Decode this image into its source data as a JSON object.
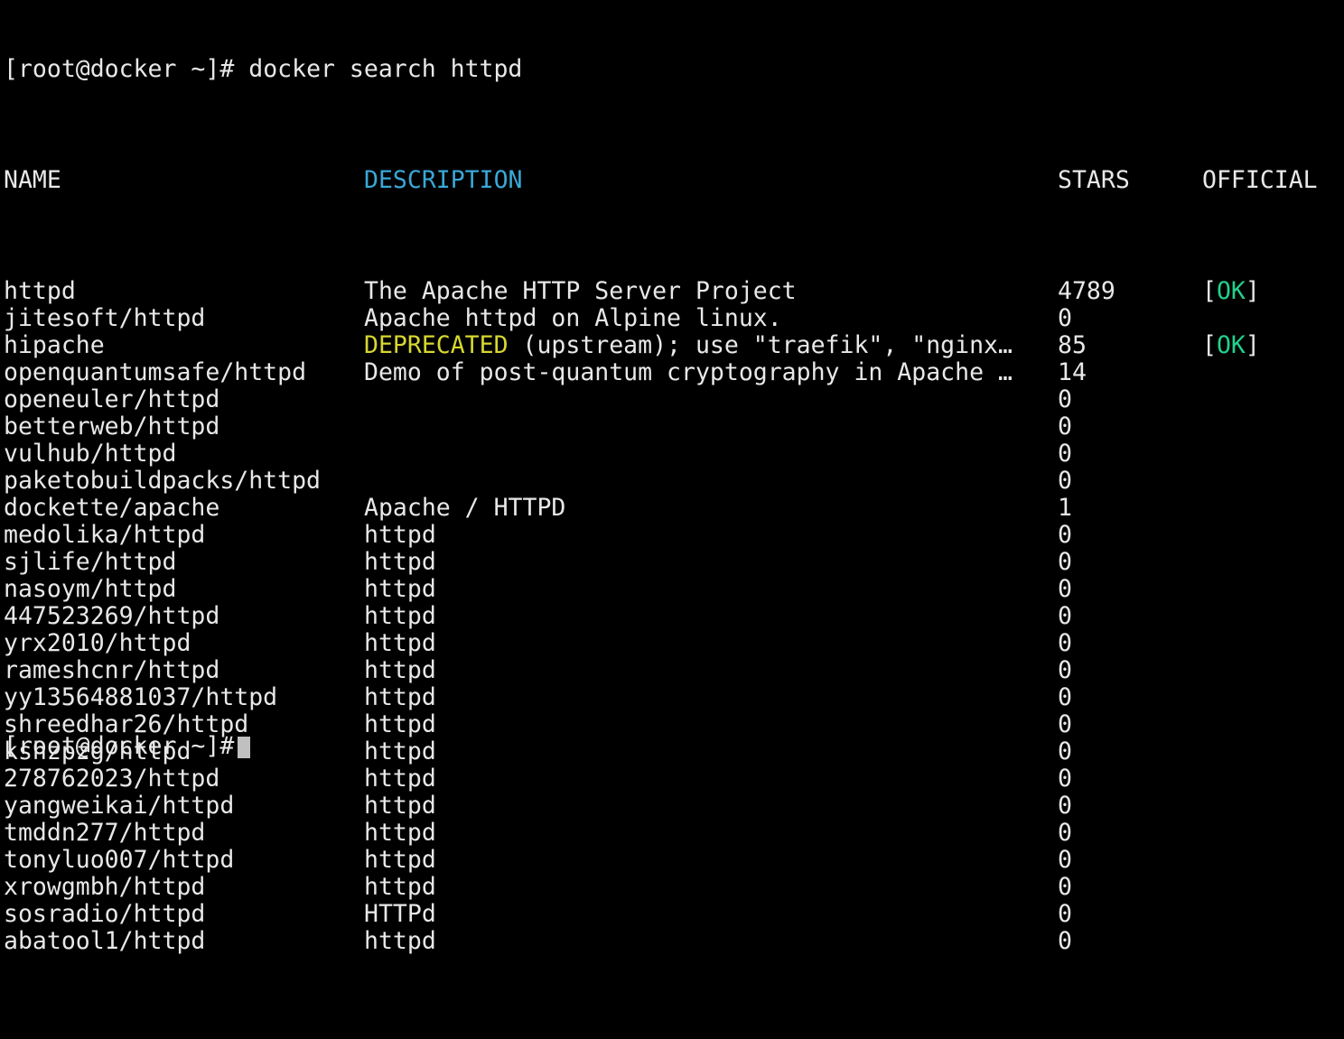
{
  "command": {
    "prompt": "[root@docker ~]#",
    "text": "docker search httpd"
  },
  "table": {
    "headers": {
      "name": "NAME",
      "description": "DESCRIPTION",
      "stars": "STARS",
      "official": "OFFICIAL"
    },
    "rows": [
      {
        "name": "httpd",
        "description": "The Apache HTTP Server Project",
        "stars": "4789",
        "official": "OK"
      },
      {
        "name": "jitesoft/httpd",
        "description": "Apache httpd on Alpine linux.",
        "stars": "0",
        "official": ""
      },
      {
        "name": "hipache",
        "description_highlight": "DEPRECATED",
        "description": " (upstream); use \"traefik\", \"nginx…",
        "stars": "85",
        "official": "OK"
      },
      {
        "name": "openquantumsafe/httpd",
        "description": "Demo of post-quantum cryptography in Apache …",
        "stars": "14",
        "official": ""
      },
      {
        "name": "openeuler/httpd",
        "description": "",
        "stars": "0",
        "official": ""
      },
      {
        "name": "betterweb/httpd",
        "description": "",
        "stars": "0",
        "official": ""
      },
      {
        "name": "vulhub/httpd",
        "description": "",
        "stars": "0",
        "official": ""
      },
      {
        "name": "paketobuildpacks/httpd",
        "description": "",
        "stars": "0",
        "official": ""
      },
      {
        "name": "dockette/apache",
        "description": "Apache / HTTPD",
        "stars": "1",
        "official": ""
      },
      {
        "name": "medolika/httpd",
        "description": "httpd",
        "stars": "0",
        "official": ""
      },
      {
        "name": "sjlife/httpd",
        "description": "httpd",
        "stars": "0",
        "official": ""
      },
      {
        "name": "nasoym/httpd",
        "description": "httpd",
        "stars": "0",
        "official": ""
      },
      {
        "name": "447523269/httpd",
        "description": "httpd",
        "stars": "0",
        "official": ""
      },
      {
        "name": "yrx2010/httpd",
        "description": "httpd",
        "stars": "0",
        "official": ""
      },
      {
        "name": "rameshcnr/httpd",
        "description": "httpd",
        "stars": "0",
        "official": ""
      },
      {
        "name": "yy13564881037/httpd",
        "description": "httpd",
        "stars": "0",
        "official": ""
      },
      {
        "name": "shreedhar26/httpd",
        "description": "httpd",
        "stars": "0",
        "official": ""
      },
      {
        "name": "kshzpzg/httpd",
        "description": "httpd",
        "stars": "0",
        "official": ""
      },
      {
        "name": "278762023/httpd",
        "description": "httpd",
        "stars": "0",
        "official": ""
      },
      {
        "name": "yangweikai/httpd",
        "description": "httpd",
        "stars": "0",
        "official": ""
      },
      {
        "name": "tmddn277/httpd",
        "description": "httpd",
        "stars": "0",
        "official": ""
      },
      {
        "name": "tonyluo007/httpd",
        "description": "httpd",
        "stars": "0",
        "official": ""
      },
      {
        "name": "xrowgmbh/httpd",
        "description": "httpd",
        "stars": "0",
        "official": ""
      },
      {
        "name": "sosradio/httpd",
        "description": "HTTPd",
        "stars": "0",
        "official": ""
      },
      {
        "name": "abatool1/httpd",
        "description": "httpd",
        "stars": "0",
        "official": ""
      }
    ]
  },
  "next_prompt": "[root@docker ~]#",
  "colors": {
    "background": "#000000",
    "foreground": "#e8e8e8",
    "header_description": "#3aa8d8",
    "deprecated": "#d7d730",
    "ok": "#23d18b"
  }
}
